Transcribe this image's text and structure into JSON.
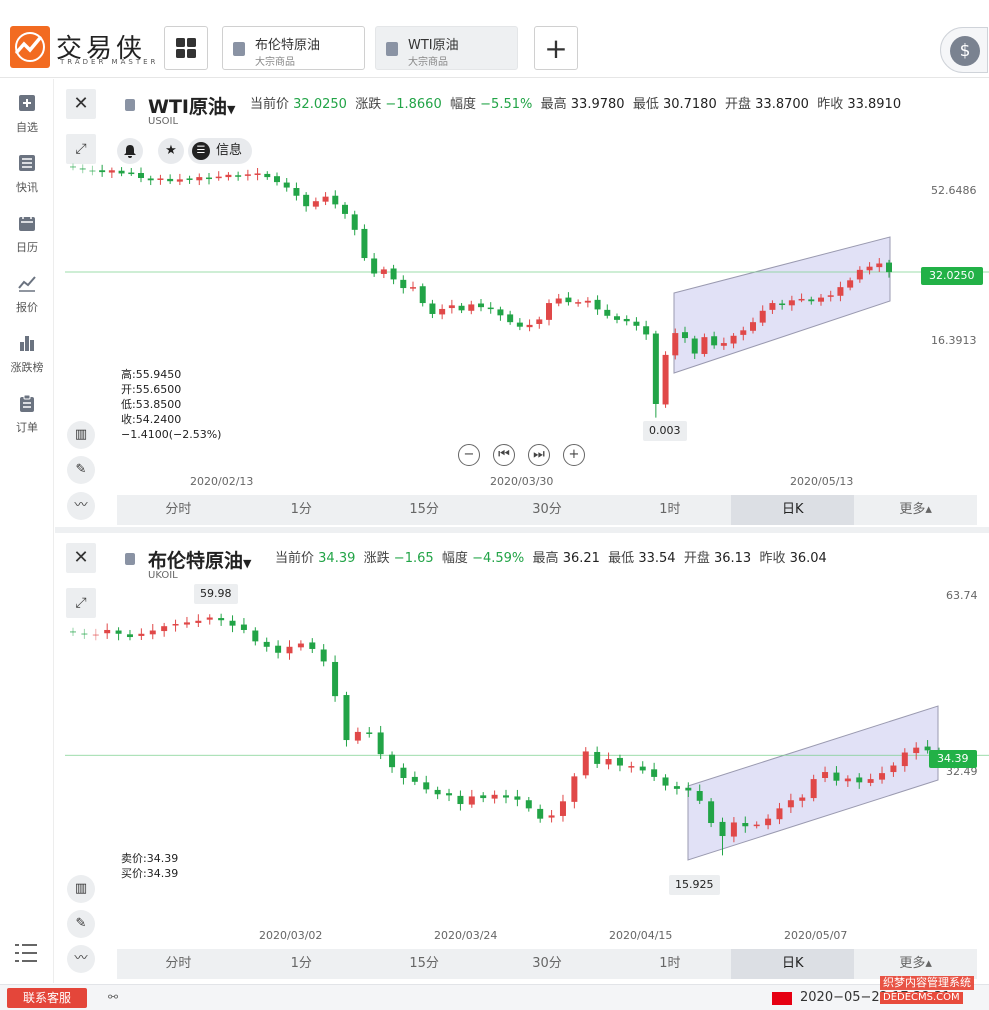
{
  "app": {
    "name": "交易侠",
    "subtitle": "TRADER MASTER"
  },
  "tabs": [
    {
      "name": "布伦特原油",
      "sub": "大宗商品"
    },
    {
      "name": "WTI原油",
      "sub": "大宗商品"
    }
  ],
  "add_tab": "+",
  "coin": "$",
  "sidebar": [
    {
      "label": "自选",
      "icon": "plus-square-icon"
    },
    {
      "label": "快讯",
      "icon": "list-icon"
    },
    {
      "label": "日历",
      "icon": "calendar-icon"
    },
    {
      "label": "报价",
      "icon": "line-chart-icon"
    },
    {
      "label": "涨跌榜",
      "icon": "bar-chart-icon"
    },
    {
      "label": "订单",
      "icon": "clipboard-icon"
    }
  ],
  "wti": {
    "name": "WTI原油",
    "code": "USOIL",
    "q_price_label": "当前价",
    "q_price": "32.0250",
    "q_chg_label": "涨跌",
    "q_chg": "−1.8660",
    "q_pct_label": "幅度",
    "q_pct": "−5.51%",
    "q_high_label": "最高",
    "q_high": "33.9780",
    "q_low_label": "最低",
    "q_low": "30.7180",
    "q_open_label": "开盘",
    "q_open": "33.8700",
    "q_prev_label": "昨收",
    "q_prev": "33.8910",
    "info": "信息",
    "ohlc": [
      "高:55.9450",
      "开:55.6500",
      "低:53.8500",
      "收:54.2400",
      "−1.4100(−2.53%)"
    ],
    "x_labels": [
      "2020/02/13",
      "2020/03/30",
      "2020/05/13"
    ],
    "y_labels": [
      "52.6486",
      "16.3913"
    ],
    "price_tag": "32.0250",
    "low_callout": "0.003"
  },
  "brent": {
    "name": "布伦特原油",
    "code": "UKOIL",
    "q_price_label": "当前价",
    "q_price": "34.39",
    "q_chg_label": "涨跌",
    "q_chg": "−1.65",
    "q_pct_label": "幅度",
    "q_pct": "−4.59%",
    "q_high_label": "最高",
    "q_high": "36.21",
    "q_low_label": "最低",
    "q_low": "33.54",
    "q_open_label": "开盘",
    "q_open": "36.13",
    "q_prev_label": "昨收",
    "q_prev": "36.04",
    "bid_ask": [
      "卖价:34.39",
      "买价:34.39"
    ],
    "x_labels": [
      "2020/03/02",
      "2020/03/24",
      "2020/04/15",
      "2020/05/07"
    ],
    "y_labels": [
      "63.74",
      "32.49"
    ],
    "price_tag": "34.39",
    "high_callout": "59.98",
    "low_callout": "15.925"
  },
  "periods": [
    "分时",
    "1分",
    "15分",
    "30分",
    "1时",
    "日K",
    "更多▴"
  ],
  "active_period": "日K",
  "status": {
    "service": "联系客服",
    "datetime": "2020−05−22 17:38:31"
  },
  "watermark": {
    "line1": "织梦内容管理系统",
    "line2": "DEDECMS.COM"
  },
  "colors": {
    "up": "#e04848",
    "down": "#22a447",
    "accent": "#f26b21",
    "channel": "#c9c9ee"
  },
  "chart_data": [
    {
      "type": "candlestick",
      "title": "WTI原油",
      "x_tick_labels": [
        "2020/02/13",
        "2020/03/30",
        "2020/05/13"
      ],
      "y_tick_labels": [
        "52.6486",
        "16.3913"
      ],
      "current_price": 32.025,
      "low_marker": 0.003,
      "closes": [
        55,
        54.5,
        54.2,
        54,
        54.4,
        53.7,
        53.9,
        52.7,
        52.2,
        52.6,
        52.0,
        52.4,
        52.3,
        52.9,
        52.5,
        53.0,
        53.4,
        53.0,
        53.5,
        53.7,
        52.9,
        51.8,
        50.6,
        48.8,
        46.5,
        47.6,
        48.6,
        46.9,
        44.8,
        41.3,
        35.1,
        31.7,
        32.6,
        30.4,
        28.5,
        28.7,
        25.2,
        22.8,
        23.9,
        24.7,
        23.6,
        24.9,
        24.3,
        23.9,
        22.5,
        21.0,
        20.0,
        20.4,
        21.6,
        25.2,
        26.2,
        25.4,
        25.4,
        25.7,
        23.8,
        22.4,
        21.5,
        21.2,
        20.2,
        18.3,
        3.0,
        13.8,
        18.6,
        17.5,
        14.1,
        17.7,
        15.9,
        16.4,
        18.0,
        19.2,
        21.0,
        23.5,
        25.2,
        24.8,
        25.8,
        26.1,
        25.6,
        26.4,
        26.9,
        28.7,
        30.2,
        32.5,
        33.2,
        33.9,
        32.0
      ]
    },
    {
      "type": "candlestick",
      "title": "布伦特原油",
      "x_tick_labels": [
        "2020/03/02",
        "2020/03/24",
        "2020/04/15",
        "2020/05/07"
      ],
      "y_tick_labels": [
        "63.74",
        "32.49"
      ],
      "current_price": 34.39,
      "high_marker": 59.98,
      "low_marker": 15.925,
      "closes": [
        57.0,
        56.6,
        56.7,
        57.5,
        56.8,
        56.2,
        56.8,
        57.4,
        58.2,
        58.6,
        58.9,
        59.2,
        59.8,
        59.3,
        58.3,
        57.5,
        55.4,
        54.4,
        53.3,
        54.4,
        55.0,
        54.0,
        51.7,
        45.3,
        37.2,
        38.7,
        38.4,
        34.6,
        32.2,
        30.2,
        29.5,
        28.1,
        27.2,
        27.0,
        25.4,
        26.8,
        26.5,
        27.1,
        26.6,
        26.2,
        24.6,
        22.7,
        23.3,
        25.9,
        30.5,
        35.1,
        32.8,
        33.7,
        32.5,
        32.4,
        31.6,
        30.4,
        28.8,
        28.2,
        27.9,
        26.0,
        21.9,
        19.5,
        22.0,
        21.3,
        21.6,
        22.7,
        24.6,
        26.1,
        26.6,
        30.0,
        31.3,
        29.7,
        30.1,
        29.4,
        30.0,
        31.1,
        32.5,
        34.9,
        35.8,
        35.3,
        34.4
      ]
    }
  ]
}
